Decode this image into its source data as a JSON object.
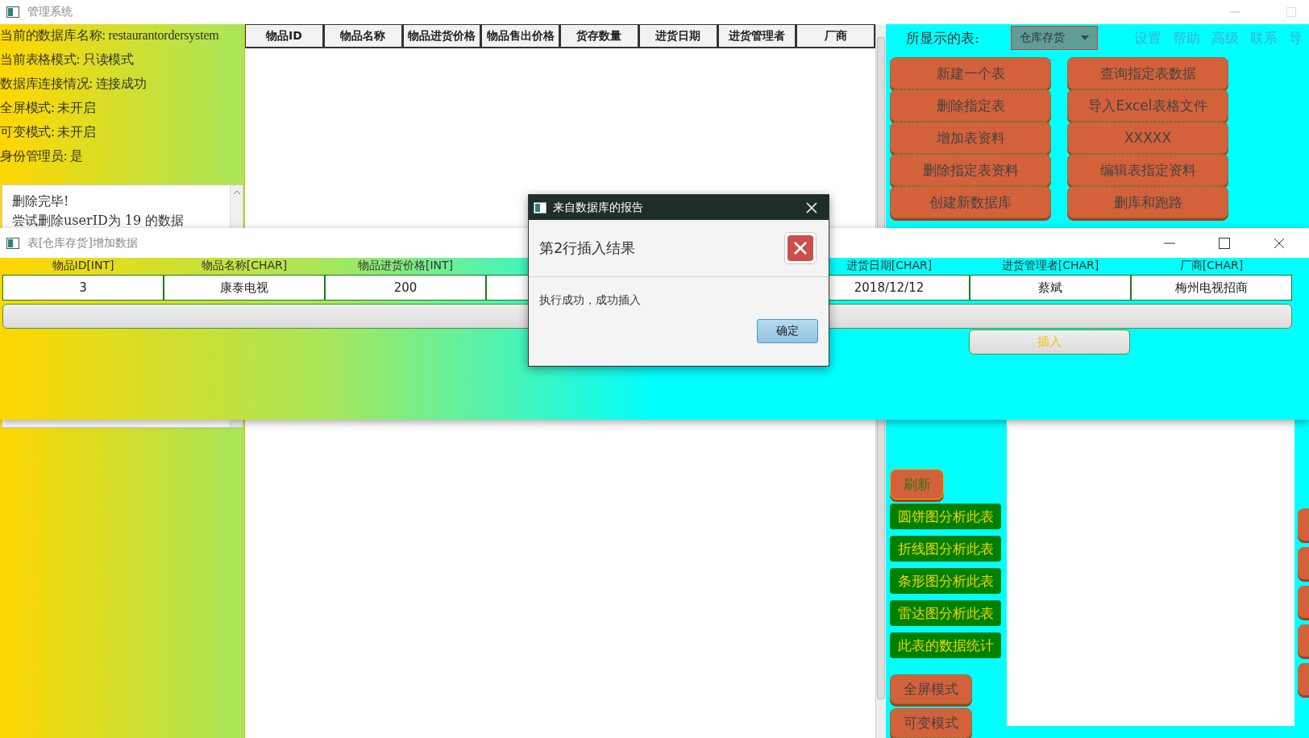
{
  "main_window": {
    "title": "管理系统"
  },
  "info_panel": {
    "lines": [
      "当前的数据库名称: restaurantordersystem",
      "当前表格模式: 只读模式",
      "数据库连接情况: 连接成功",
      "全屏模式: 未开启",
      "可变模式: 未开启",
      "身份管理员: 是"
    ]
  },
  "log": {
    "lines": [
      "删除完毕!",
      "尝试删除userID为 19 的数据"
    ]
  },
  "table": {
    "columns": [
      "物品ID",
      "物品名称",
      "物品进货价格",
      "物品售出价格",
      "货存数量",
      "进货日期",
      "进货管理者",
      "厂商"
    ]
  },
  "right_panel": {
    "table_label": "所显示的表:",
    "table_select": "仓库存货",
    "links": [
      "设置",
      "帮助",
      "高级",
      "联系",
      "导"
    ],
    "actions": [
      "新建一个表",
      "查询指定表数据",
      "删除指定表",
      "导入Excel表格文件",
      "增加表资料",
      "XXXXX",
      "删除指定表资料",
      "编辑表指定资料",
      "创建新数据库",
      "删库和跑路"
    ],
    "refresh": "刷新",
    "analysis": [
      "圆饼图分析此表",
      "折线图分析此表",
      "条形图分析此表",
      "雷达图分析此表",
      "此表的数据统计"
    ],
    "modes": [
      "全屏模式",
      "可变模式"
    ]
  },
  "insert_window": {
    "title": "表[仓库存货]增加数据",
    "fields": [
      {
        "header": "物品ID[INT]",
        "value": "3"
      },
      {
        "header": "物品名称[CHAR]",
        "value": "康泰电视"
      },
      {
        "header": "物品进货价格[INT]",
        "value": "200"
      },
      {
        "header": "进货日期[CHAR]",
        "value": "2018/12/12"
      },
      {
        "header": "进货管理者[CHAR]",
        "value": "蔡斌"
      },
      {
        "header": "厂商[CHAR]",
        "value": "梅州电视招商"
      }
    ],
    "submit": "插入"
  },
  "dialog": {
    "title": "来自数据库的报告",
    "header": "第2行插入结果",
    "message": "执行成功，成功插入",
    "button": "确定"
  }
}
